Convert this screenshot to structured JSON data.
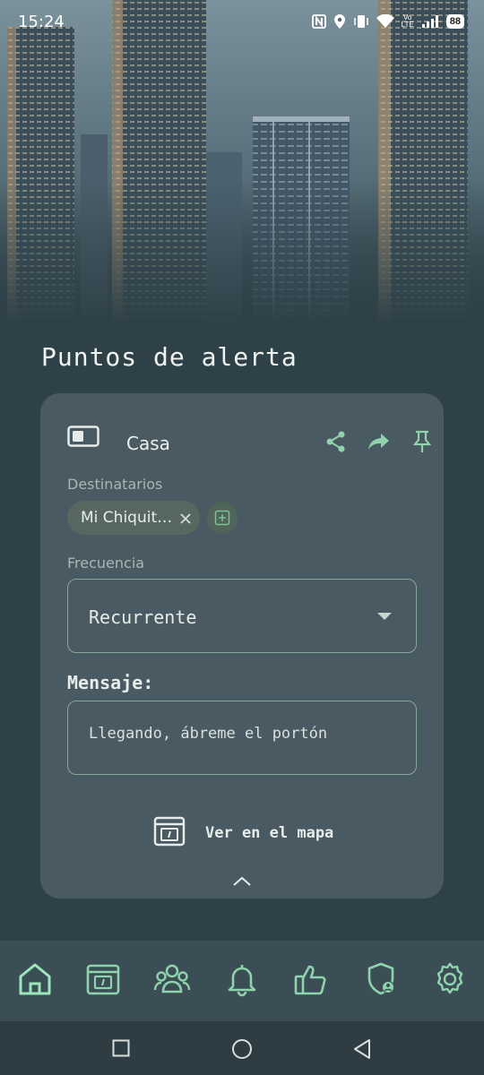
{
  "status_bar": {
    "time": "15:24",
    "volte_line1": "Vo",
    "volte_line2": "LTE",
    "battery": "88"
  },
  "section": {
    "title": "Puntos de alerta"
  },
  "card": {
    "title": "Casa",
    "recipients_label": "Destinatarios",
    "recipient_chip": "Mi Chiquit…",
    "frequency_label": "Frecuencia",
    "frequency_value": "Recurrente",
    "message_label": "Mensaje:",
    "message_value": "Llegando, ábreme el portón",
    "map_button_label": "Ver en el mapa"
  },
  "bottom_nav": {
    "items": [
      "home-icon",
      "map-card-icon",
      "group-icon",
      "bell-icon",
      "thumbs-up-icon",
      "shield-user-icon",
      "gear-icon"
    ],
    "active": "home-icon"
  },
  "colors": {
    "accent": "#8fd3ad",
    "background": "#2f4148",
    "card": "#4a5a62"
  }
}
